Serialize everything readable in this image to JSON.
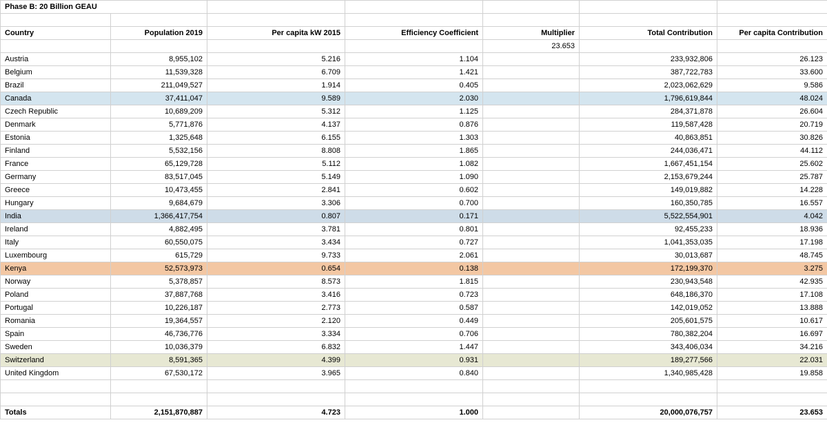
{
  "title": "Phase B: 20 Billion GEAU",
  "headers": {
    "country": "Country",
    "population": "Population 2019",
    "percapita_kw": "Per capita  kW 2015",
    "efficiency": "Efficiency Coefficient",
    "multiplier": "Multiplier",
    "total_contrib": "Total Contribution",
    "percapita_contrib": "Per capita Contribution"
  },
  "multiplier_value": "23.653",
  "rows": [
    {
      "country": "Austria",
      "pop": "8,955,102",
      "kw": "5.216",
      "eff": "1.104",
      "tot": "233,932,806",
      "pcc": "26.123",
      "hl": ""
    },
    {
      "country": "Belgium",
      "pop": "11,539,328",
      "kw": "6.709",
      "eff": "1.421",
      "tot": "387,722,783",
      "pcc": "33.600",
      "hl": ""
    },
    {
      "country": "Brazil",
      "pop": "211,049,527",
      "kw": "1.914",
      "eff": "0.405",
      "tot": "2,023,062,629",
      "pcc": "9.586",
      "hl": ""
    },
    {
      "country": "Canada",
      "pop": "37,411,047",
      "kw": "9.589",
      "eff": "2.030",
      "tot": "1,796,619,844",
      "pcc": "48.024",
      "hl": "hl-blue"
    },
    {
      "country": "Czech Republic",
      "pop": "10,689,209",
      "kw": "5.312",
      "eff": "1.125",
      "tot": "284,371,878",
      "pcc": "26.604",
      "hl": ""
    },
    {
      "country": "Denmark",
      "pop": "5,771,876",
      "kw": "4.137",
      "eff": "0.876",
      "tot": "119,587,428",
      "pcc": "20.719",
      "hl": ""
    },
    {
      "country": "Estonia",
      "pop": "1,325,648",
      "kw": "6.155",
      "eff": "1.303",
      "tot": "40,863,851",
      "pcc": "30.826",
      "hl": ""
    },
    {
      "country": "Finland",
      "pop": "5,532,156",
      "kw": "8.808",
      "eff": "1.865",
      "tot": "244,036,471",
      "pcc": "44.112",
      "hl": ""
    },
    {
      "country": "France",
      "pop": "65,129,728",
      "kw": "5.112",
      "eff": "1.082",
      "tot": "1,667,451,154",
      "pcc": "25.602",
      "hl": ""
    },
    {
      "country": "Germany",
      "pop": "83,517,045",
      "kw": "5.149",
      "eff": "1.090",
      "tot": "2,153,679,244",
      "pcc": "25.787",
      "hl": ""
    },
    {
      "country": "Greece",
      "pop": "10,473,455",
      "kw": "2.841",
      "eff": "0.602",
      "tot": "149,019,882",
      "pcc": "14.228",
      "hl": ""
    },
    {
      "country": "Hungary",
      "pop": "9,684,679",
      "kw": "3.306",
      "eff": "0.700",
      "tot": "160,350,785",
      "pcc": "16.557",
      "hl": ""
    },
    {
      "country": "India",
      "pop": "1,366,417,754",
      "kw": "0.807",
      "eff": "0.171",
      "tot": "5,522,554,901",
      "pcc": "4.042",
      "hl": "hl-blue2"
    },
    {
      "country": "Ireland",
      "pop": "4,882,495",
      "kw": "3.781",
      "eff": "0.801",
      "tot": "92,455,233",
      "pcc": "18.936",
      "hl": ""
    },
    {
      "country": "Italy",
      "pop": "60,550,075",
      "kw": "3.434",
      "eff": "0.727",
      "tot": "1,041,353,035",
      "pcc": "17.198",
      "hl": ""
    },
    {
      "country": "Luxembourg",
      "pop": "615,729",
      "kw": "9.733",
      "eff": "2.061",
      "tot": "30,013,687",
      "pcc": "48.745",
      "hl": ""
    },
    {
      "country": "Kenya",
      "pop": "52,573,973",
      "kw": "0.654",
      "eff": "0.138",
      "tot": "172,199,370",
      "pcc": "3.275",
      "hl": "hl-orange"
    },
    {
      "country": "Norway",
      "pop": "5,378,857",
      "kw": "8.573",
      "eff": "1.815",
      "tot": "230,943,548",
      "pcc": "42.935",
      "hl": ""
    },
    {
      "country": "Poland",
      "pop": "37,887,768",
      "kw": "3.416",
      "eff": "0.723",
      "tot": "648,186,370",
      "pcc": "17.108",
      "hl": ""
    },
    {
      "country": "Portugal",
      "pop": "10,226,187",
      "kw": "2.773",
      "eff": "0.587",
      "tot": "142,019,052",
      "pcc": "13.888",
      "hl": ""
    },
    {
      "country": "Romania",
      "pop": "19,364,557",
      "kw": "2.120",
      "eff": "0.449",
      "tot": "205,601,575",
      "pcc": "10.617",
      "hl": ""
    },
    {
      "country": "Spain",
      "pop": "46,736,776",
      "kw": "3.334",
      "eff": "0.706",
      "tot": "780,382,204",
      "pcc": "16.697",
      "hl": ""
    },
    {
      "country": "Sweden",
      "pop": "10,036,379",
      "kw": "6.832",
      "eff": "1.447",
      "tot": "343,406,034",
      "pcc": "34.216",
      "hl": ""
    },
    {
      "country": "Switzerland",
      "pop": "8,591,365",
      "kw": "4.399",
      "eff": "0.931",
      "tot": "189,277,566",
      "pcc": "22.031",
      "hl": "hl-olive"
    },
    {
      "country": "United Kingdom",
      "pop": "67,530,172",
      "kw": "3.965",
      "eff": "0.840",
      "tot": "1,340,985,428",
      "pcc": "19.858",
      "hl": ""
    }
  ],
  "totals": {
    "label": "Totals",
    "pop": "2,151,870,887",
    "kw": "4.723",
    "eff": "1.000",
    "tot": "20,000,076,757",
    "pcc": "23.653"
  }
}
